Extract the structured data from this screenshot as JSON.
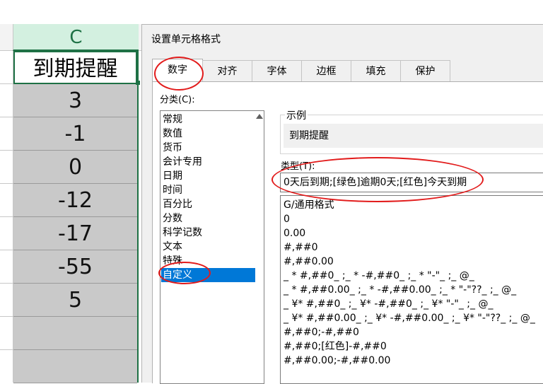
{
  "sheet": {
    "column_letter": "C",
    "header_cell": "到期提醒",
    "values": [
      "3",
      "-1",
      "0",
      "-12",
      "-17",
      "-55",
      "5",
      "",
      ""
    ]
  },
  "dialog": {
    "title": "设置单元格格式",
    "tabs": [
      "数字",
      "对齐",
      "字体",
      "边框",
      "填充",
      "保护"
    ],
    "active_tab": "数字",
    "category_label": "分类(C):",
    "categories": [
      "常规",
      "数值",
      "货币",
      "会计专用",
      "日期",
      "时间",
      "百分比",
      "分数",
      "科学记数",
      "文本",
      "特殊",
      "自定义"
    ],
    "selected_category": "自定义",
    "sample_label": "示例",
    "sample_value": "到期提醒",
    "type_label": "类型(T):",
    "type_value": "0天后到期;[绿色]逾期0天;[红色]今天到期",
    "format_list": [
      "G/通用格式",
      "0",
      "0.00",
      "#,##0",
      "#,##0.00",
      "_ * #,##0_ ;_ * -#,##0_ ;_ * \"-\"_ ;_ @_",
      "_ * #,##0.00_ ;_ * -#,##0.00_ ;_ * \"-\"??_ ;_ @_",
      "_ ¥* #,##0_ ;_ ¥* -#,##0_ ;_ ¥* \"-\"_ ;_ @_",
      "_ ¥* #,##0.00_ ;_ ¥* -#,##0.00_ ;_ ¥* \"-\"??_ ;_ @_",
      "#,##0;-#,##0",
      "#,##0;[红色]-#,##0",
      "#,##0.00;-#,##0.00"
    ]
  },
  "colors": {
    "annotation": "#e21b1b",
    "selection": "#0078d7",
    "excel_green": "#1e7145",
    "cell_fill": "#c9c9c9"
  }
}
